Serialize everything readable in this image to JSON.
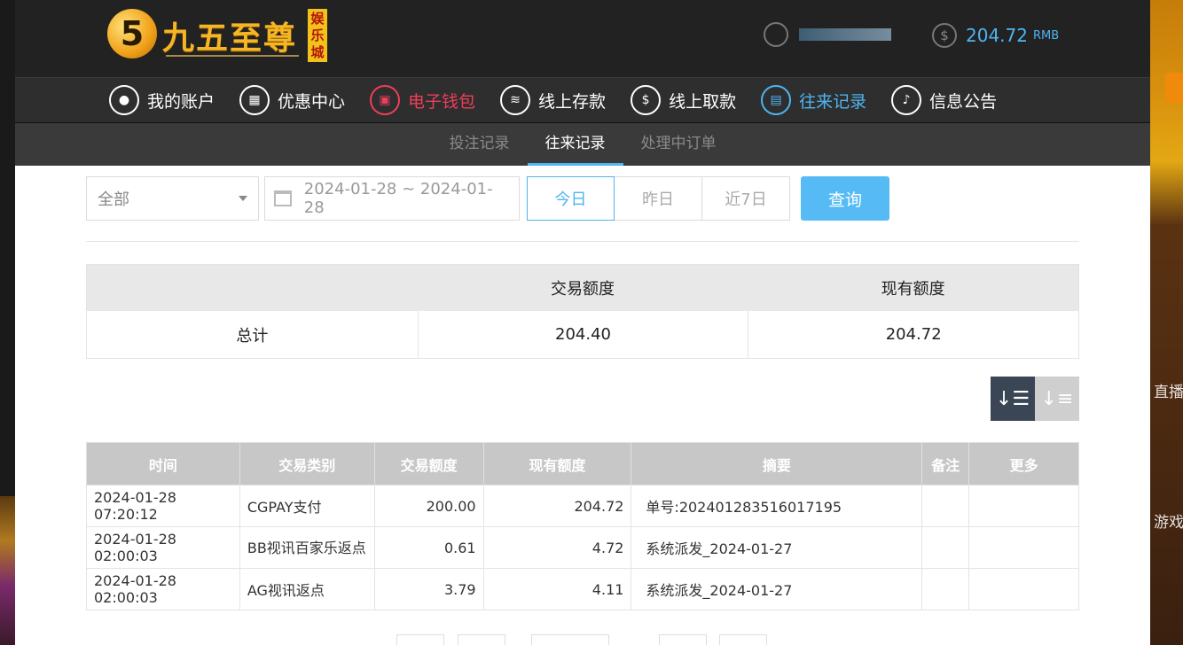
{
  "brand": {
    "coin": "5",
    "name": "九五至尊",
    "tag": "娱乐城"
  },
  "account": {
    "balance": "204.72",
    "currency": "RMB"
  },
  "main_nav": [
    {
      "label": "我的账户",
      "icon": "user-icon"
    },
    {
      "label": "优惠中心",
      "icon": "gift-icon"
    },
    {
      "label": "电子钱包",
      "icon": "wallet-icon"
    },
    {
      "label": "线上存款",
      "icon": "deposit-icon"
    },
    {
      "label": "线上取款",
      "icon": "withdraw-icon"
    },
    {
      "label": "往来记录",
      "icon": "records-icon"
    },
    {
      "label": "信息公告",
      "icon": "bell-icon"
    }
  ],
  "sub_nav": [
    "投注记录",
    "往来记录",
    "处理中订单"
  ],
  "filters": {
    "type_value": "全部",
    "date_range": "2024-01-28 ~ 2024-01-28",
    "quick": [
      "今日",
      "昨日",
      "近7日"
    ],
    "query_label": "查询"
  },
  "summary": {
    "headers": [
      "",
      "交易额度",
      "现有额度"
    ],
    "label": "总计",
    "trade_amount": "204.40",
    "current_amount": "204.72"
  },
  "table": {
    "headers": [
      "时间",
      "交易类别",
      "交易额度",
      "现有额度",
      "摘要",
      "备注",
      "更多"
    ],
    "rows": [
      {
        "time": "2024-01-28 07:20:12",
        "category": "CGPAY支付",
        "amount": "200.00",
        "balance": "204.72",
        "summary": "单号:202401283516017195",
        "note": "",
        "more": ""
      },
      {
        "time": "2024-01-28 02:00:03",
        "category": "BB视讯百家乐返点",
        "amount": "0.61",
        "balance": "4.72",
        "summary": "系统派发_2024-01-27",
        "note": "",
        "more": ""
      },
      {
        "time": "2024-01-28 02:00:03",
        "category": "AG视讯返点",
        "amount": "3.79",
        "balance": "4.11",
        "summary": "系统派发_2024-01-27",
        "note": "",
        "more": ""
      }
    ]
  },
  "side_labels": {
    "live": "直播",
    "games": "游戏"
  }
}
